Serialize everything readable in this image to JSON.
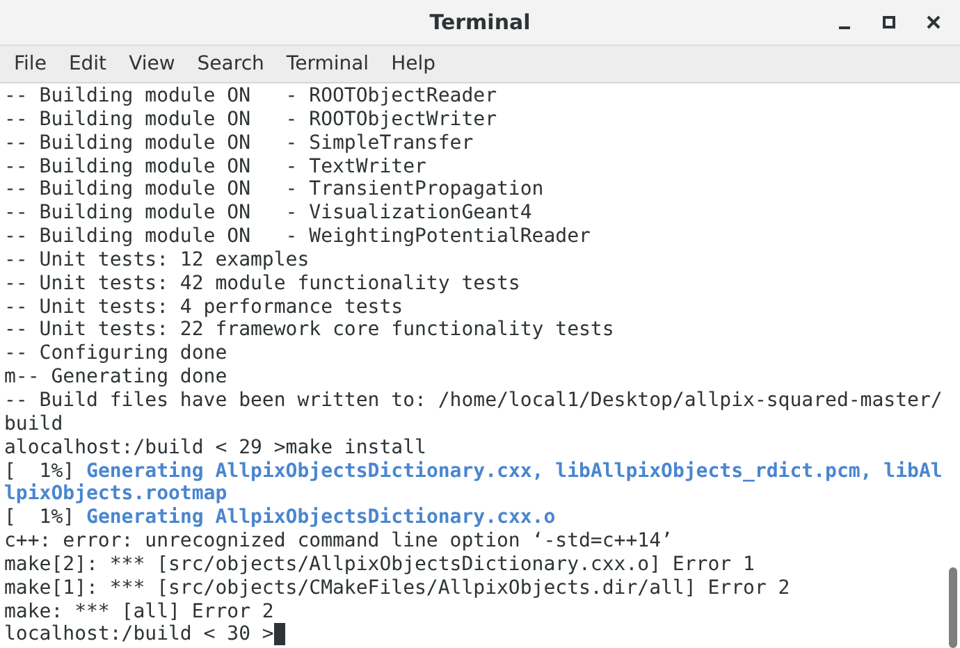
{
  "window": {
    "title": "Terminal"
  },
  "menu": [
    {
      "label": "File"
    },
    {
      "label": "Edit"
    },
    {
      "label": "View"
    },
    {
      "label": "Search"
    },
    {
      "label": "Terminal"
    },
    {
      "label": "Help"
    }
  ],
  "terminal": {
    "lines": [
      {
        "kind": "output",
        "text": "-- Building module ON   - ROOTObjectReader"
      },
      {
        "kind": "output",
        "text": "-- Building module ON   - ROOTObjectWriter"
      },
      {
        "kind": "output",
        "text": "-- Building module ON   - SimpleTransfer"
      },
      {
        "kind": "output",
        "text": "-- Building module ON   - TextWriter"
      },
      {
        "kind": "output",
        "text": "-- Building module ON   - TransientPropagation"
      },
      {
        "kind": "output",
        "text": "-- Building module ON   - VisualizationGeant4"
      },
      {
        "kind": "output",
        "text": "-- Building module ON   - WeightingPotentialReader"
      },
      {
        "kind": "output",
        "text": "-- Unit tests: 12 examples"
      },
      {
        "kind": "output",
        "text": "-- Unit tests: 42 module functionality tests"
      },
      {
        "kind": "output",
        "text": "-- Unit tests: 4 performance tests"
      },
      {
        "kind": "output",
        "text": "-- Unit tests: 22 framework core functionality tests"
      },
      {
        "kind": "output",
        "text": "-- Configuring done"
      },
      {
        "kind": "output",
        "text": "m-- Generating done"
      },
      {
        "kind": "output",
        "text": "-- Build files have been written to: /home/local1/Desktop/allpix-squared-master/"
      },
      {
        "kind": "output",
        "text": "build"
      },
      {
        "kind": "output",
        "text": "alocalhost:/build < 29 >make install"
      },
      {
        "kind": "progress",
        "prefix": "[  1%] ",
        "text": "Generating AllpixObjectsDictionary.cxx, libAllpixObjects_rdict.pcm, libAl"
      },
      {
        "kind": "progress_wrap",
        "text": "lpixObjects.rootmap"
      },
      {
        "kind": "progress",
        "prefix": "[  1%] ",
        "text": "Generating AllpixObjectsDictionary.cxx.o"
      },
      {
        "kind": "output",
        "text": "c++: error: unrecognized command line option ‘-std=c++14’"
      },
      {
        "kind": "output",
        "text": "make[2]: *** [src/objects/AllpixObjectsDictionary.cxx.o] Error 1"
      },
      {
        "kind": "output",
        "text": "make[1]: *** [src/objects/CMakeFiles/AllpixObjects.dir/all] Error 2"
      },
      {
        "kind": "output",
        "text": "make: *** [all] Error 2"
      },
      {
        "kind": "prompt",
        "text": "localhost:/build < 30 >"
      }
    ]
  }
}
